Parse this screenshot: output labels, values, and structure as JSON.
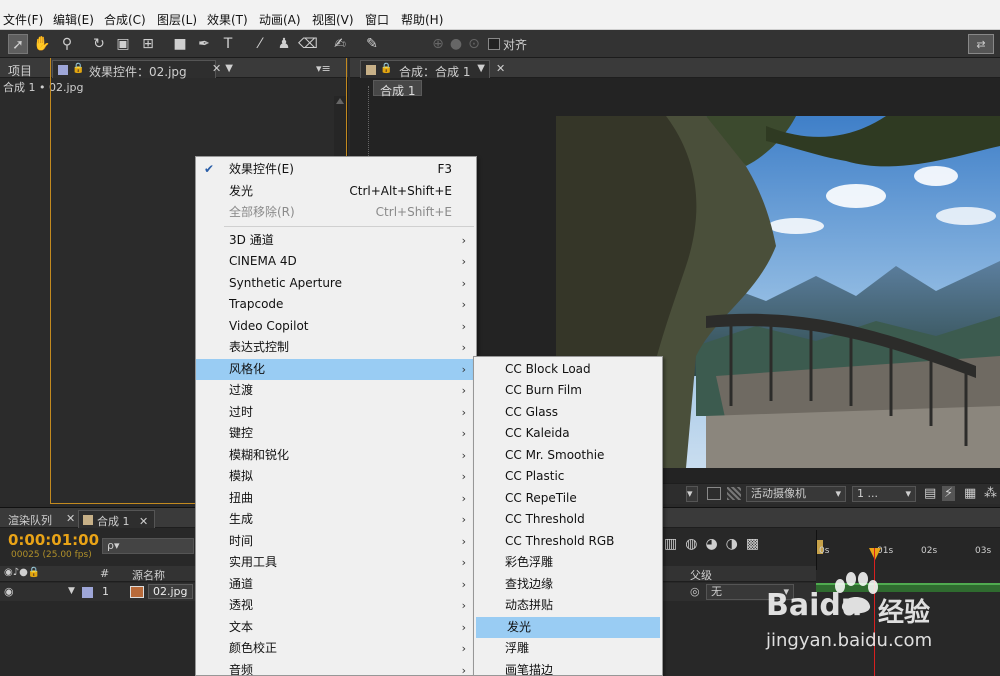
{
  "menubar": {
    "items": [
      "文件(F)",
      "编辑(E)",
      "合成(C)",
      "图层(L)",
      "效果(T)",
      "动画(A)",
      "视图(V)",
      "窗口",
      "帮助(H)"
    ]
  },
  "toolbar": {
    "align_label": "对齐"
  },
  "left_panel": {
    "tab_project": "项目",
    "tab_effects": "效果控件：02.jpg",
    "breadcrumb": "合成 1 • 02.jpg"
  },
  "comp_panel": {
    "tab_label": "合成：合成 1",
    "subtab": "合成 1"
  },
  "viewer_bar": {
    "camera": "活动摄像机",
    "views": "1 ..."
  },
  "timeline": {
    "tab_render": "渲染队列",
    "tab_comp": "合成 1",
    "timecode": "0:00:01:00",
    "frames": "00025 (25.00 fps)",
    "search_placeholder": "ρ▾",
    "col_num": "#",
    "col_source": "源名称",
    "col_parent": "父级",
    "layer_num": "1",
    "layer_name": "02.jpg",
    "parent_value": "无",
    "ruler": [
      "0s",
      "01s",
      "02s",
      "03s"
    ]
  },
  "context_menu": {
    "items": [
      {
        "label": "效果控件(E)",
        "shortcut": "F3",
        "checked": true
      },
      {
        "label": "发光",
        "shortcut": "Ctrl+Alt+Shift+E"
      },
      {
        "label": "全部移除(R)",
        "shortcut": "Ctrl+Shift+E",
        "disabled": true
      },
      {
        "label": "3D 通道",
        "submenu": true
      },
      {
        "label": "CINEMA 4D",
        "submenu": true
      },
      {
        "label": "Synthetic Aperture",
        "submenu": true
      },
      {
        "label": "Trapcode",
        "submenu": true
      },
      {
        "label": "Video Copilot",
        "submenu": true
      },
      {
        "label": "表达式控制",
        "submenu": true
      },
      {
        "label": "风格化",
        "submenu": true,
        "highlighted": true
      },
      {
        "label": "过渡",
        "submenu": true
      },
      {
        "label": "过时",
        "submenu": true
      },
      {
        "label": "键控",
        "submenu": true
      },
      {
        "label": "模糊和锐化",
        "submenu": true
      },
      {
        "label": "模拟",
        "submenu": true
      },
      {
        "label": "扭曲",
        "submenu": true
      },
      {
        "label": "生成",
        "submenu": true
      },
      {
        "label": "时间",
        "submenu": true
      },
      {
        "label": "实用工具",
        "submenu": true
      },
      {
        "label": "通道",
        "submenu": true
      },
      {
        "label": "透视",
        "submenu": true
      },
      {
        "label": "文本",
        "submenu": true
      },
      {
        "label": "颜色校正",
        "submenu": true
      },
      {
        "label": "音频",
        "submenu": true
      }
    ]
  },
  "submenu": {
    "items": [
      {
        "label": "CC Block Load"
      },
      {
        "label": "CC Burn Film"
      },
      {
        "label": "CC Glass"
      },
      {
        "label": "CC Kaleida"
      },
      {
        "label": "CC Mr. Smoothie"
      },
      {
        "label": "CC Plastic"
      },
      {
        "label": "CC RepeTile"
      },
      {
        "label": "CC Threshold"
      },
      {
        "label": "CC Threshold RGB"
      },
      {
        "label": "彩色浮雕"
      },
      {
        "label": "查找边缘"
      },
      {
        "label": "动态拼贴"
      },
      {
        "label": "发光",
        "highlighted": true
      },
      {
        "label": "浮雕"
      },
      {
        "label": "画笔描边"
      }
    ]
  },
  "watermark": {
    "brand": "Baidu",
    "brand_cn": "经验",
    "url": "jingyan.baidu.com"
  },
  "colors": {
    "menu_highlight": "#99ccf3",
    "panel_focus": "#c38a1f",
    "timecode": "#e8a317",
    "playhead": "#d82020"
  }
}
